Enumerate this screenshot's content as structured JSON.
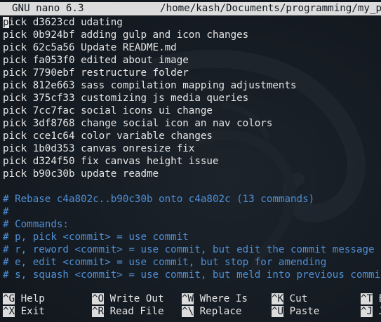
{
  "titlebar": {
    "app": "GNU nano 6.3",
    "path": "/home/kash/Documents/programming/my_port"
  },
  "todo": [
    {
      "cmd": "pick",
      "hash": "d3623cd",
      "msg": "udating"
    },
    {
      "cmd": "pick",
      "hash": "0b924bf",
      "msg": "adding gulp and icon changes"
    },
    {
      "cmd": "pick",
      "hash": "62c5a56",
      "msg": "Update README.md"
    },
    {
      "cmd": "pick",
      "hash": "fa053f0",
      "msg": "edited about image"
    },
    {
      "cmd": "pick",
      "hash": "7790ebf",
      "msg": "restructure folder"
    },
    {
      "cmd": "pick",
      "hash": "812e663",
      "msg": "sass compilation mapping adjustments"
    },
    {
      "cmd": "pick",
      "hash": "375cf33",
      "msg": "customizing js media queries"
    },
    {
      "cmd": "pick",
      "hash": "7cc7fac",
      "msg": "social icons ui change"
    },
    {
      "cmd": "pick",
      "hash": "3df8768",
      "msg": "change social icon an nav colors"
    },
    {
      "cmd": "pick",
      "hash": "cce1c64",
      "msg": "color variable changes"
    },
    {
      "cmd": "pick",
      "hash": "1b0d353",
      "msg": "canvas onresize fix"
    },
    {
      "cmd": "pick",
      "hash": "d324f50",
      "msg": "fix canvas height issue"
    },
    {
      "cmd": "pick",
      "hash": "b90c30b",
      "msg": "update readme"
    }
  ],
  "comments": [
    "# Rebase c4a802c..b90c30b onto c4a802c (13 commands)",
    "#",
    "# Commands:",
    "# p, pick <commit> = use commit",
    "# r, reword <commit> = use commit, but edit the commit message",
    "# e, edit <commit> = use commit, but stop for amending",
    "# s, squash <commit> = use commit, but meld into previous commit"
  ],
  "shortcuts": {
    "row1": [
      {
        "key": "^G",
        "label": "Help"
      },
      {
        "key": "^O",
        "label": "Write Out"
      },
      {
        "key": "^W",
        "label": "Where Is"
      },
      {
        "key": "^K",
        "label": "Cut"
      },
      {
        "key": "^T",
        "label": "E"
      }
    ],
    "row2": [
      {
        "key": "^X",
        "label": "Exit"
      },
      {
        "key": "^R",
        "label": "Read File"
      },
      {
        "key": "^\\",
        "label": "Replace"
      },
      {
        "key": "^U",
        "label": "Paste"
      },
      {
        "key": "^J",
        "label": "J"
      }
    ]
  },
  "colors": {
    "background": "#141a21",
    "text": "#e6e6e6",
    "comment": "#4f8fd6",
    "highlight": "#dcdcdc"
  }
}
